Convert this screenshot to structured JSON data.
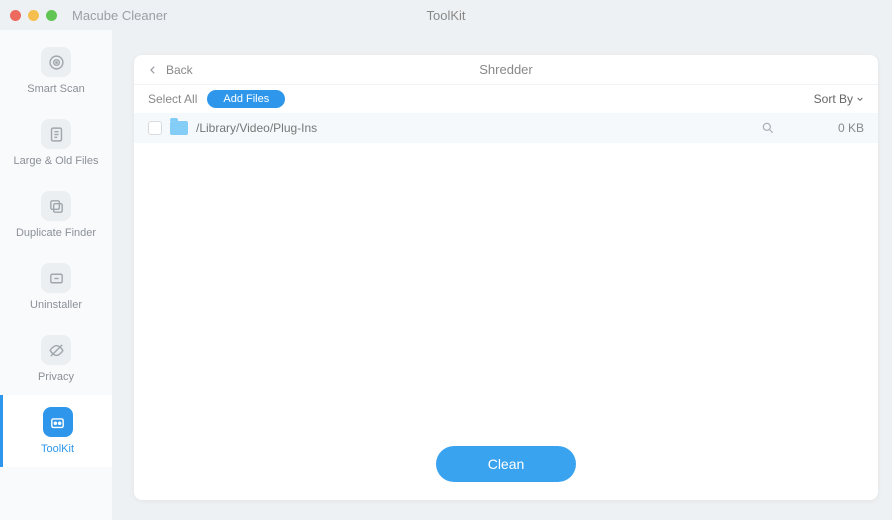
{
  "titlebar": {
    "app_name": "Macube Cleaner",
    "page": "ToolKit"
  },
  "sidebar": {
    "items": [
      {
        "label": "Smart Scan"
      },
      {
        "label": "Large & Old Files"
      },
      {
        "label": "Duplicate Finder"
      },
      {
        "label": "Uninstaller"
      },
      {
        "label": "Privacy"
      },
      {
        "label": "ToolKit"
      }
    ]
  },
  "panel": {
    "back_label": "Back",
    "title": "Shredder"
  },
  "toolbar": {
    "select_all": "Select All",
    "add_files": "Add Files",
    "sort_by": "Sort By"
  },
  "files": [
    {
      "path": "/Library/Video/Plug-Ins",
      "size": "0 KB"
    }
  ],
  "footer": {
    "clean": "Clean"
  }
}
